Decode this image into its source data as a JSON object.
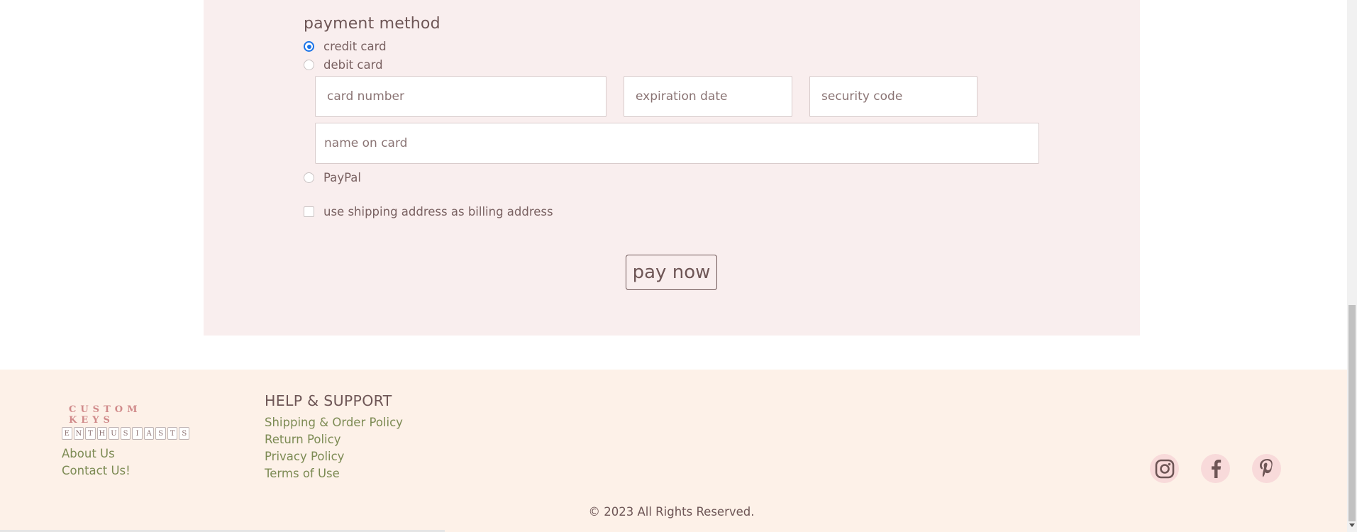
{
  "payment": {
    "title": "payment method",
    "options": [
      {
        "label": "credit card",
        "selected": true
      },
      {
        "label": "debit card",
        "selected": false
      },
      {
        "label": "PayPal",
        "selected": false
      }
    ],
    "fields": {
      "card_number_placeholder": "card number",
      "expiration_placeholder": "expiration date",
      "security_placeholder": "security code",
      "name_placeholder": "name on card"
    },
    "billing_checkbox_label": "use shipping address as billing address",
    "billing_checked": false,
    "pay_button": "pay now"
  },
  "footer": {
    "logo": {
      "line1": "CUSTOM KEYS",
      "line2_letters": [
        "E",
        "N",
        "T",
        "H",
        "U",
        "S",
        "I",
        "A",
        "S",
        "T",
        "S"
      ]
    },
    "about_links": [
      "About Us",
      "Contact Us!"
    ],
    "help_title": "HELP & SUPPORT",
    "help_links": [
      "Shipping & Order Policy",
      "Return Policy",
      "Privacy Policy",
      "Terms of Use"
    ],
    "social": [
      "instagram-icon",
      "facebook-icon",
      "pinterest-icon"
    ],
    "copyright": "© 2023 All Rights Reserved."
  },
  "colors": {
    "panel_bg": "#f9eeee",
    "footer_bg": "#fdf1e8",
    "link_green": "#7d8b54",
    "radio_blue": "#1a73e8"
  }
}
